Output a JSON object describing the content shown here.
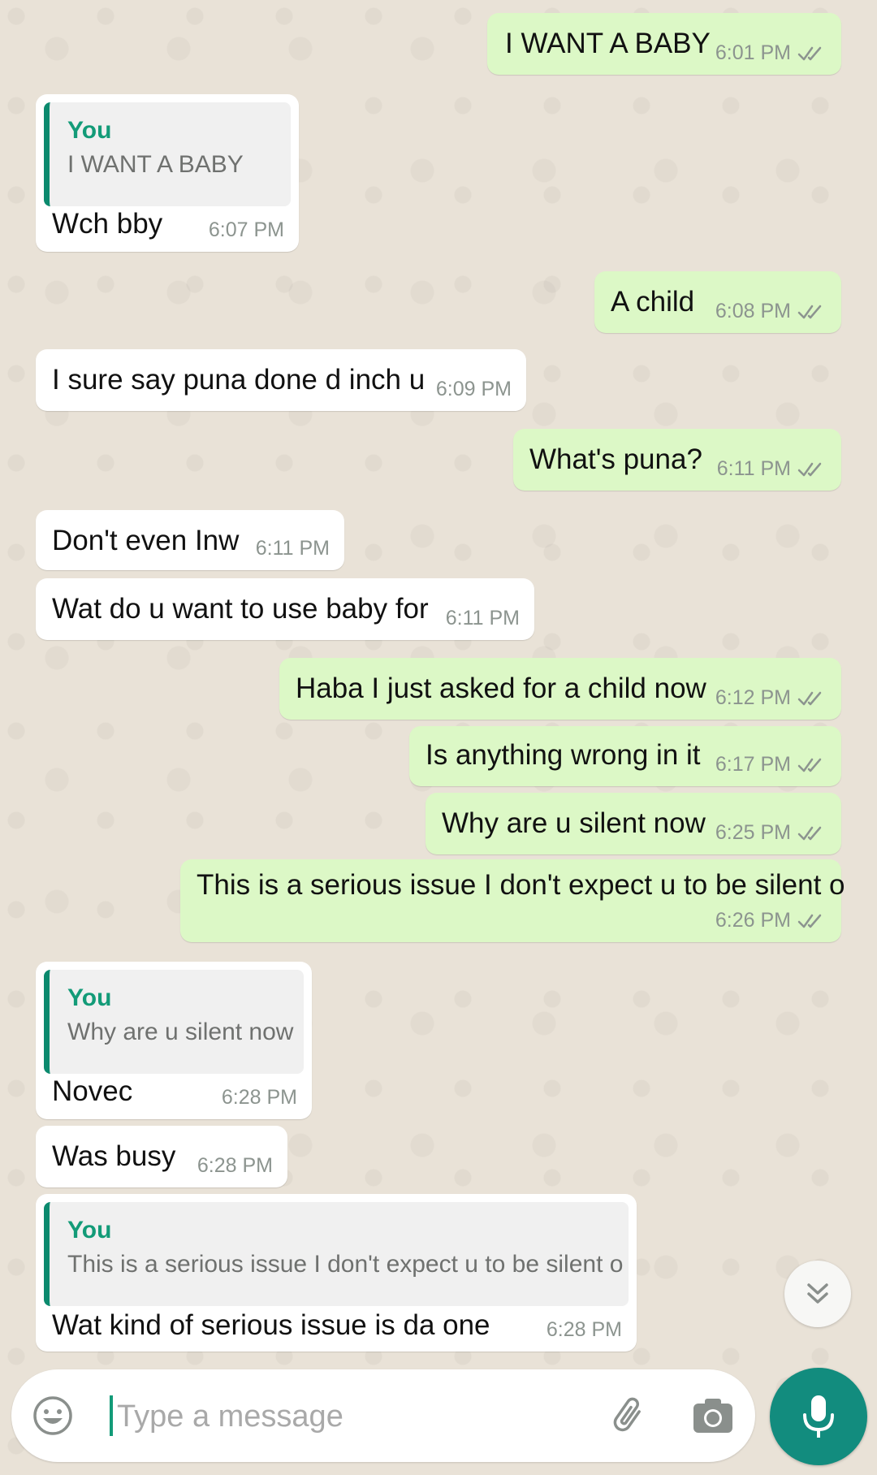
{
  "colors": {
    "outgoing_bubble": "#dcf8c6",
    "incoming_bubble": "#ffffff",
    "quote_accent": "#139b78",
    "mic_button": "#128c7e",
    "wallpaper": "#e9e2d7"
  },
  "messages": [
    {
      "direction": "out",
      "text": "I WANT A BABY",
      "time": "6:01 PM",
      "status": "read-ticks"
    },
    {
      "direction": "in",
      "quote": {
        "name": "You",
        "text": "I WANT A BABY"
      },
      "text": "Wch bby",
      "time": "6:07 PM"
    },
    {
      "direction": "out",
      "text": "A child",
      "time": "6:08 PM",
      "status": "read-ticks"
    },
    {
      "direction": "in",
      "text": "I sure say puna done d inch u",
      "time": "6:09 PM"
    },
    {
      "direction": "out",
      "text": "What's puna?",
      "time": "6:11 PM",
      "status": "read-ticks"
    },
    {
      "direction": "in",
      "text": "Don't even Inw",
      "time": "6:11 PM"
    },
    {
      "direction": "in",
      "text": "Wat do u want to use baby for",
      "time": "6:11 PM"
    },
    {
      "direction": "out",
      "text": "Haba I just asked for a child now",
      "time": "6:12 PM",
      "status": "read-ticks"
    },
    {
      "direction": "out",
      "text": "Is anything wrong in it",
      "time": "6:17 PM",
      "status": "read-ticks"
    },
    {
      "direction": "out",
      "text": "Why are u silent now",
      "time": "6:25 PM",
      "status": "read-ticks"
    },
    {
      "direction": "out",
      "text": "This is a serious issue I don't expect u to be silent o",
      "time": "6:26 PM",
      "status": "read-ticks"
    },
    {
      "direction": "in",
      "quote": {
        "name": "You",
        "text": "Why are u silent now"
      },
      "text": "Novec",
      "time": "6:28 PM"
    },
    {
      "direction": "in",
      "text": "Was busy",
      "time": "6:28 PM"
    },
    {
      "direction": "in",
      "quote": {
        "name": "You",
        "text": "This is a serious issue I don't expect u to be silent o"
      },
      "text": "Wat kind of serious issue is da one",
      "time": "6:28 PM"
    }
  ],
  "composer": {
    "placeholder": "Type a message",
    "emoji_icon": "emoji-icon",
    "attach_icon": "paperclip-icon",
    "camera_icon": "camera-icon",
    "mic_icon": "microphone-icon"
  },
  "scroll_down_icon": "double-chevron-down-icon"
}
